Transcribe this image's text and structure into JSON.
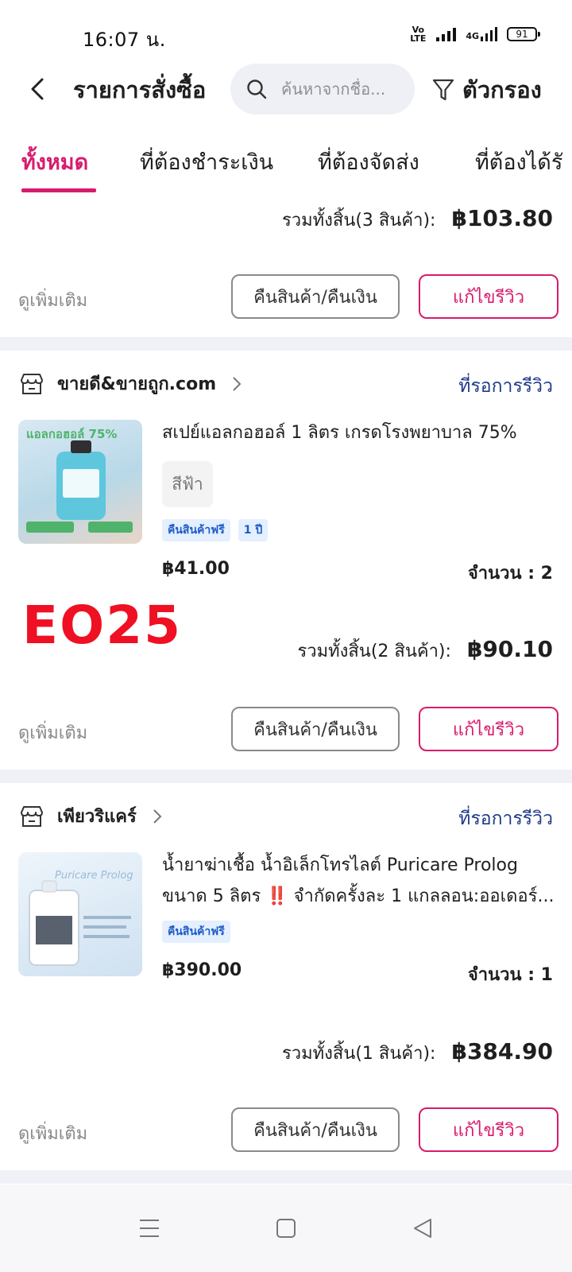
{
  "status_bar": {
    "time": "16:07 น.",
    "volte": "Vo LTE",
    "network": "4G",
    "battery": "91"
  },
  "header": {
    "title": "รายการสั่งซื้อ",
    "search_placeholder": "ค้นหาจากชื่อ...",
    "filter_label": "ตัวกรอง"
  },
  "tabs": [
    {
      "label": "ทั้งหมด",
      "active": true
    },
    {
      "label": "ที่ต้องชำระเงิน",
      "active": false
    },
    {
      "label": "ที่ต้องจัดส่ง",
      "active": false
    },
    {
      "label": "ที่ต้องได้รั",
      "active": false
    }
  ],
  "order0": {
    "total_label": "รวมทั้งสิ้น(3 สินค้า):",
    "total_amount": "฿103.80",
    "more_label": "ดูเพิ่มเติม",
    "refund_label": "คืนสินค้า/คืนเงิน",
    "review_label": "แก้ไขรีวิว"
  },
  "order1": {
    "shop_name": "ขายดี&ขายถูก.com",
    "status": "ที่รอการรีวิว",
    "product_name": "สเปย์แอลกอฮอล์  1 ลิตร   เกรดโรงพยาบาล  75%",
    "variant": "สีฟ้า",
    "badges": [
      "คืนสินค้าฟรี",
      "1 ปี"
    ],
    "price": "฿41.00",
    "quantity": "จำนวน : 2",
    "total_label": "รวมทั้งสิ้น(2 สินค้า):",
    "total_amount": "฿90.10",
    "more_label": "ดูเพิ่มเติม",
    "refund_label": "คืนสินค้า/คืนเงิน",
    "review_label": "แก้ไขรีวิว",
    "thumb_text": "แอลกอฮอล์ 75%"
  },
  "stamp": "EO25",
  "order2": {
    "shop_name": "เพียวริแคร์",
    "status": "ที่รอการรีวิว",
    "product_name_line1": "น้ำยาฆ่าเชื้อ น้ำอิเล็กโทรไลต์ Puricare Prolog",
    "product_name_line2": "ขนาด 5 ลิตร ‼️ จำกัดครั้งละ 1 แกลลอน:ออเดอร์...",
    "badges": [
      "คืนสินค้าฟรี"
    ],
    "price": "฿390.00",
    "quantity": "จำนวน : 1",
    "total_label": "รวมทั้งสิ้น(1 สินค้า):",
    "total_amount": "฿384.90",
    "more_label": "ดูเพิ่มเติม",
    "refund_label": "คืนสินค้า/คืนเงิน",
    "review_label": "แก้ไขรีวิว",
    "thumb_text": "Puricare Prolog"
  },
  "colors": {
    "accent": "#d81b6d",
    "link": "#1e3a8a",
    "badge_bg": "#e4efff",
    "badge_text": "#1e5bc6",
    "separator": "#f0f1f6",
    "stamp": "#ef1023"
  },
  "icons": {
    "back": "back-arrow-icon",
    "search": "search-icon",
    "filter": "filter-funnel-icon",
    "shop": "shop-store-icon",
    "chevron": "chevron-right-icon",
    "nav_menu": "menu-lines-icon",
    "nav_home": "square-home-icon",
    "nav_back": "triangle-back-icon"
  }
}
